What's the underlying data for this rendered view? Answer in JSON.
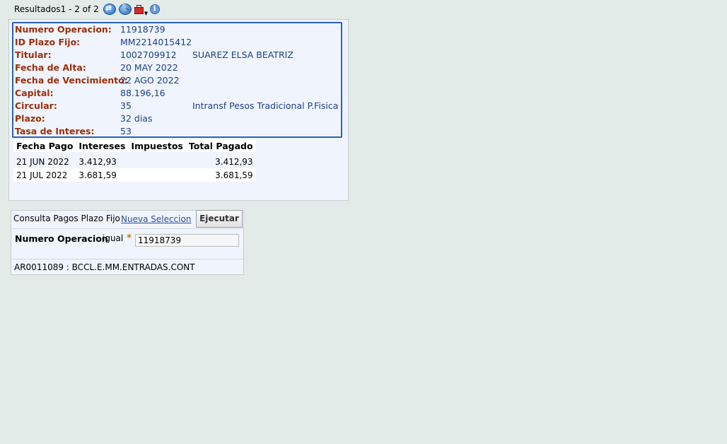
{
  "toolbar": {
    "results_label": "Resultados1 - 2 of 2",
    "icons": [
      "navigate-icon",
      "search-icon",
      "toolbox-icon",
      "info-icon"
    ]
  },
  "detail": {
    "fields": [
      {
        "label": "Numero Operacion:",
        "value": "11918739",
        "value2": ""
      },
      {
        "label": "ID Plazo Fijo:",
        "value": "MM2214015412",
        "value2": ""
      },
      {
        "label": "Titular:",
        "value": "1002709912",
        "value2": "SUAREZ ELSA BEATRIZ"
      },
      {
        "label": "Fecha de Alta:",
        "value": "20 MAY 2022",
        "value2": ""
      },
      {
        "label": "Fecha de Vencimiento:",
        "value": "22 AGO 2022",
        "value2": ""
      },
      {
        "label": "Capital:",
        "value": "88.196,16",
        "value2": ""
      },
      {
        "label": "Circular:",
        "value": "35",
        "value2": "Intransf Pesos Tradicional P.Fisica"
      },
      {
        "label": "Plazo:",
        "value": "32 dias",
        "value2": ""
      },
      {
        "label": "Tasa de Interes:",
        "value": "53",
        "value2": ""
      }
    ]
  },
  "payments": {
    "headers": [
      "Fecha Pago",
      "Intereses",
      "Impuestos",
      "Total Pagado"
    ],
    "rows": [
      [
        "21 JUN 2022",
        "3.412,93",
        "",
        "3.412,93"
      ],
      [
        "21 JUL 2022",
        "3.681,59",
        "",
        "3.681,59"
      ]
    ]
  },
  "query": {
    "tab_label": "Consulta Pagos Plazo Fijo",
    "new_selection_link": "Nueva Seleccion",
    "execute_button": "Ejecutar",
    "field_label": "Numero Operacion",
    "operator": "igual",
    "required_mark": "*",
    "field_value": "11918739",
    "footer": "AR0011089 : BCCL.E.MM.ENTRADAS.CONT"
  },
  "colors": {
    "background": "#e2ebe8",
    "label": "#9b2e0a",
    "value": "#1c3f86",
    "border": "#2a63b5"
  }
}
